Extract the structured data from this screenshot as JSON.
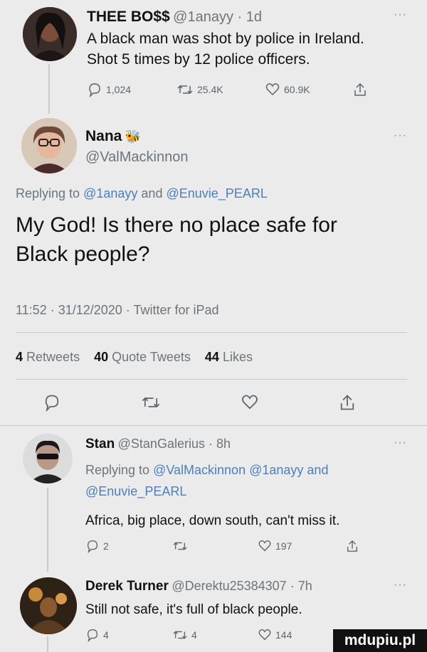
{
  "tweets": [
    {
      "author": "THEE BO$$",
      "handle": "@1anayy",
      "time": "1d",
      "text_line1": "A black man was shot by police in Ireland.",
      "text_line2": "Shot 5 times by 12 police officers.",
      "replies": "1,024",
      "retweets": "25.4K",
      "likes": "60.9K"
    }
  ],
  "main_tweet": {
    "author": "Nana",
    "author_emoji": "🐝",
    "handle": "@ValMackinnon",
    "replying_prefix": "Replying to",
    "replying_to_1": "@1anayy",
    "replying_and": "and",
    "replying_to_2": "@Enuvie_PEARL",
    "text_line1": "My God!  Is there no place safe for",
    "text_line2": "Black people?",
    "timestamp": "11:52 · 31/12/2020 · Twitter for iPad",
    "retweets_count": "4",
    "retweets_label": "Retweets",
    "quotes_count": "40",
    "quotes_label": "Quote Tweets",
    "likes_count": "44",
    "likes_label": "Likes"
  },
  "replies": [
    {
      "author": "Stan",
      "handle": "@StanGalerius",
      "time": "8h",
      "replying_prefix": "Replying to",
      "replying_line1_mentions": "@ValMackinnon @1anayy",
      "replying_and": "and",
      "replying_line2_mentions": "@Enuvie_PEARL",
      "text": "Africa, big place, down south, can't miss it.",
      "replies": "2",
      "retweets": "",
      "likes": "197"
    },
    {
      "author": "Derek Turner",
      "handle": "@Derektu25384307",
      "time": "7h",
      "text": "Still not safe, it's full of black people.",
      "replies": "4",
      "retweets": "4",
      "likes": "144"
    }
  ],
  "watermark": "mdupiu.pl",
  "colors": {
    "background": "#ebebeb",
    "link": "#4a7fc0",
    "secondary": "#6f7478",
    "divider": "#c9c9c9"
  }
}
